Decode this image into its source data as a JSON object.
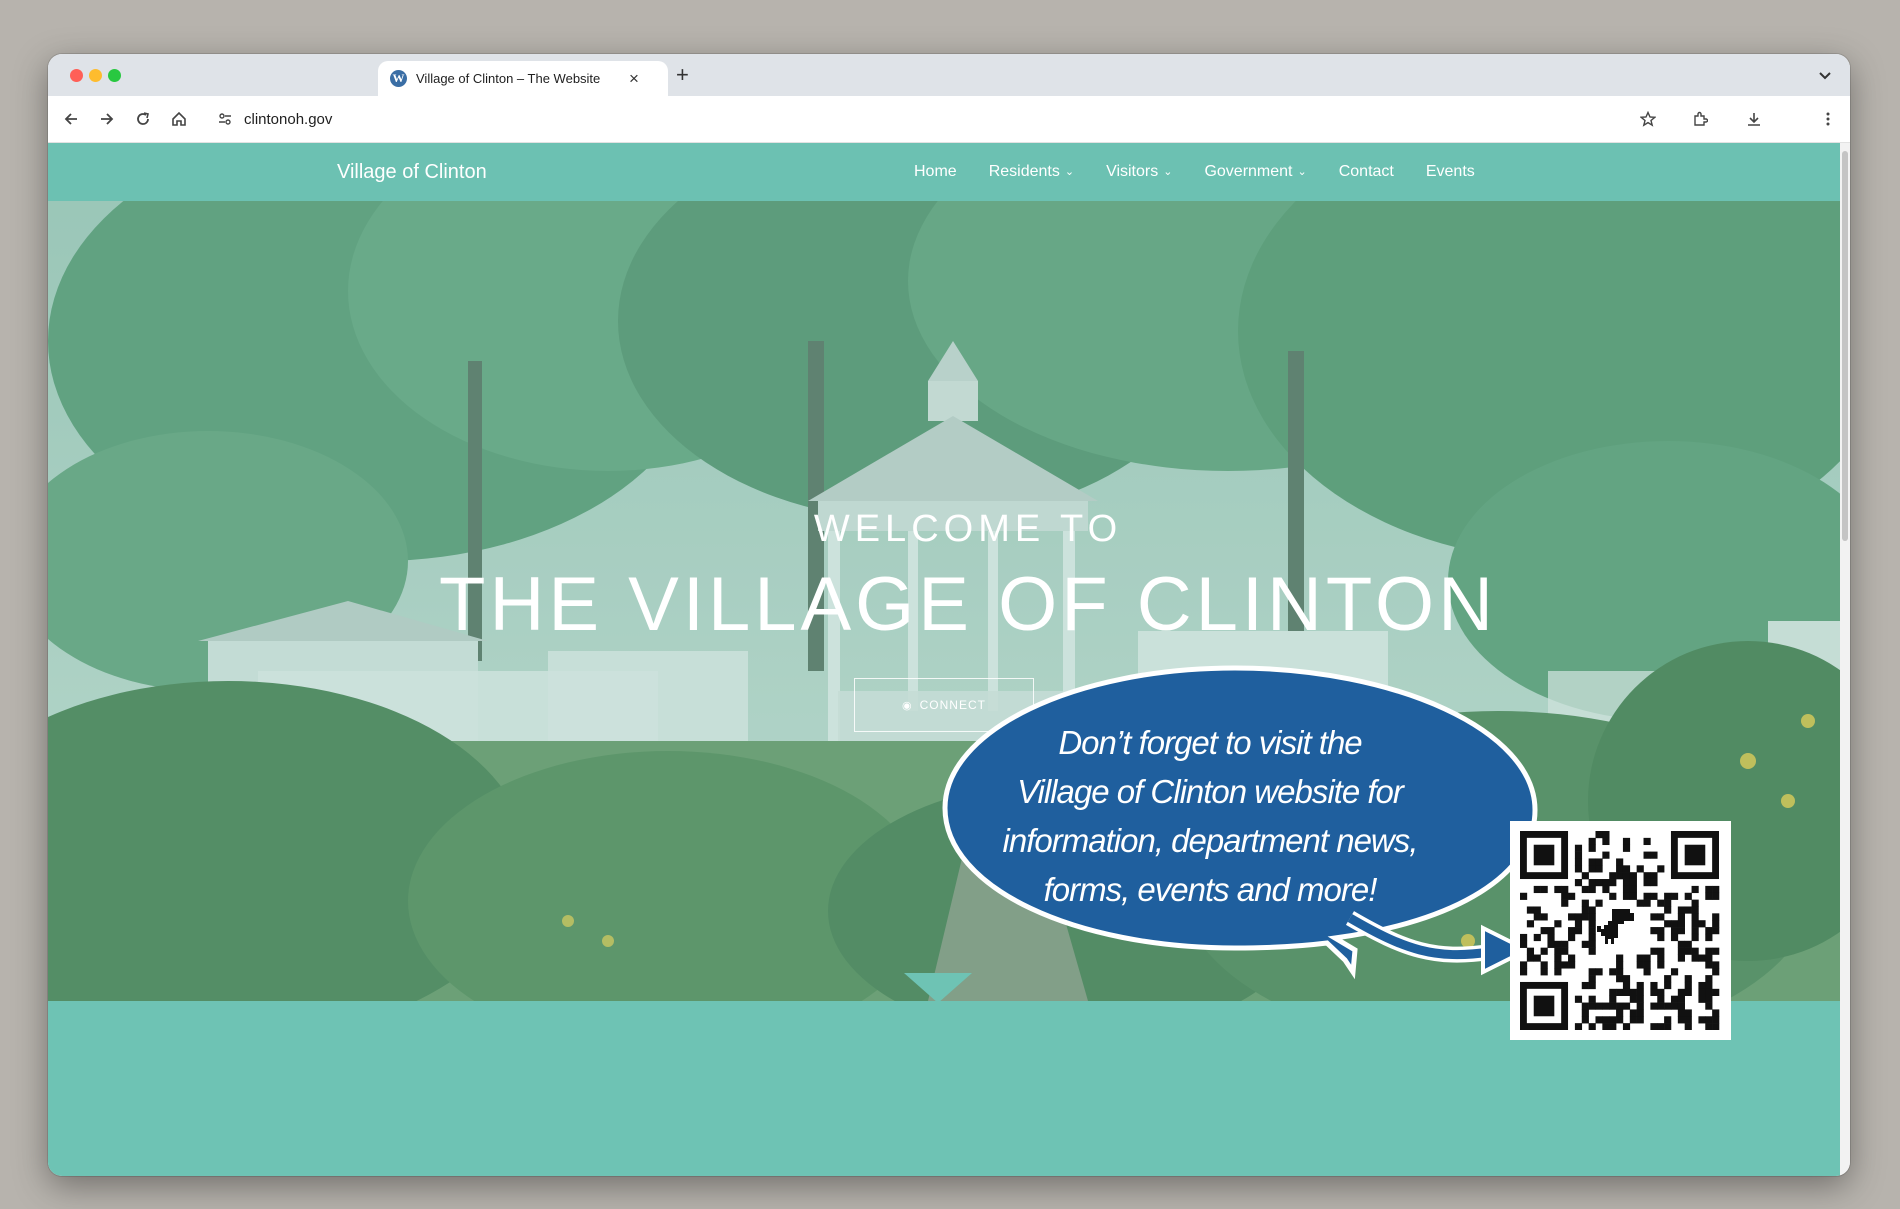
{
  "browser": {
    "tab_title": "Village of Clinton – The Website",
    "tab_favicon": "W",
    "new_tab": "+",
    "close": "×",
    "url": "clintonoh.gov"
  },
  "site": {
    "name": "Village of Clinton",
    "nav": [
      {
        "label": "Home",
        "has_dropdown": false
      },
      {
        "label": "Residents",
        "has_dropdown": true
      },
      {
        "label": "Visitors",
        "has_dropdown": true
      },
      {
        "label": "Government",
        "has_dropdown": true
      },
      {
        "label": "Contact",
        "has_dropdown": false
      },
      {
        "label": "Events",
        "has_dropdown": false
      }
    ],
    "chevron": "⌄"
  },
  "hero": {
    "welcome": "WELCOME TO",
    "title": "THE VILLAGE OF CLINTON",
    "button_label": "CONNECT"
  },
  "callout": {
    "lines": [
      "Don’t forget to visit the",
      "Village of Clinton website for",
      "information, department news,",
      "forms, events and more!"
    ]
  },
  "colors": {
    "site_teal": "#6ec3b4",
    "bubble_blue": "#1f5f9e",
    "bubble_outline": "#ffffff"
  },
  "icons": [
    "back-arrow-icon",
    "forward-arrow-icon",
    "reload-icon",
    "home-icon",
    "site-settings-icon",
    "bookmark-star-icon",
    "extensions-icon",
    "download-icon",
    "more-menu-icon",
    "qr-code-icon",
    "dinosaur-icon"
  ]
}
